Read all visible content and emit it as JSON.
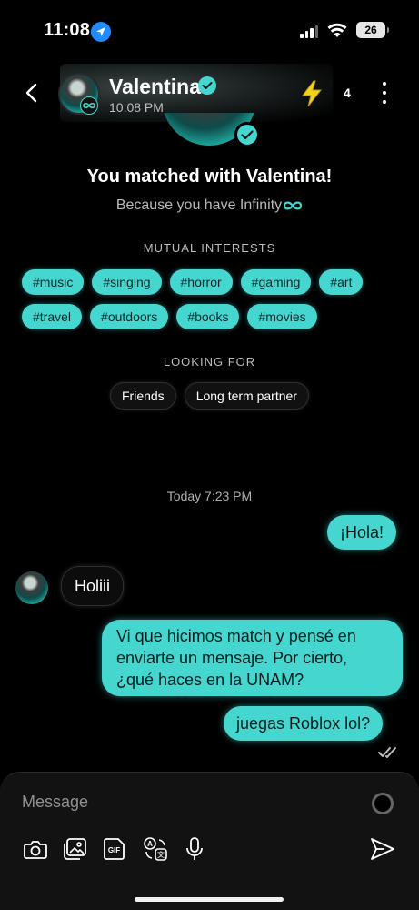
{
  "status_bar": {
    "time": "11:08",
    "battery": "26"
  },
  "header": {
    "name": "Valentina",
    "last_seen": "10:08 PM",
    "boost_count": "4"
  },
  "match": {
    "title": "You matched with Valentina!",
    "subtitle": "Because you have Infinity"
  },
  "interests": {
    "label": "MUTUAL INTERESTS",
    "row1": [
      "#music",
      "#singing",
      "#horror",
      "#gaming",
      "#art"
    ],
    "row2": [
      "#travel",
      "#outdoors",
      "#books",
      "#movies"
    ]
  },
  "looking_for": {
    "label": "LOOKING FOR",
    "items": [
      "Friends",
      "Long term partner"
    ]
  },
  "chat": {
    "day_stamp": "Today 7:23 PM",
    "messages": [
      {
        "from": "me",
        "text": "¡Hola!"
      },
      {
        "from": "them",
        "text": "Holiii"
      },
      {
        "from": "me",
        "text": "Vi que hicimos match y pensé en enviarte un mensaje. Por cierto, ¿qué haces en la UNAM?"
      },
      {
        "from": "me",
        "text": "juegas Roblox lol?"
      }
    ]
  },
  "composer": {
    "placeholder": "Message"
  },
  "icons": [
    "location-arrow-icon",
    "signal-icon",
    "wifi-icon",
    "battery-icon",
    "back-icon",
    "infinity-icon",
    "verified-icon",
    "lightning-bolt-icon",
    "more-icon",
    "camera-icon",
    "photo-icon",
    "gif-icon",
    "translate-icon",
    "microphone-icon",
    "send-icon",
    "double-check-icon"
  ],
  "colors": {
    "accent": "#45d6d0",
    "background": "#000000",
    "bolt": "#f5d21a"
  }
}
